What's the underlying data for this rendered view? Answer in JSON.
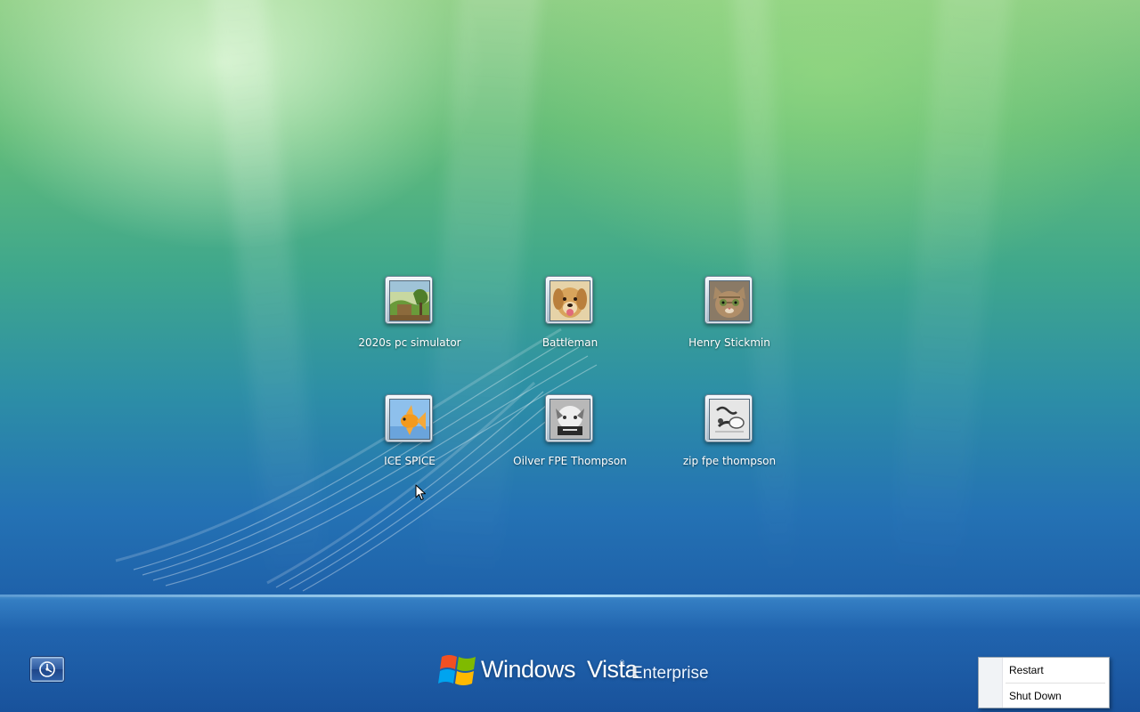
{
  "users": [
    {
      "name": "2020s pc simulator",
      "picture": "landscape-picture"
    },
    {
      "name": "Battleman",
      "picture": "dog-picture"
    },
    {
      "name": "Henry Stickmin",
      "picture": "kitten-picture"
    },
    {
      "name": "ICE SPICE",
      "picture": "goldfish-picture"
    },
    {
      "name": "Oilver FPE Thompson",
      "picture": "grayscale-picture"
    },
    {
      "name": "zip fpe thompson",
      "picture": "sketch-picture"
    }
  ],
  "branding": {
    "windows": "Windows",
    "vista": "Vista",
    "trademark": "®",
    "edition": "Enterprise"
  },
  "power_menu": {
    "items": [
      "Restart",
      "Shut Down"
    ]
  },
  "ease_of_access": {
    "icon": "ease-of-access-icon"
  },
  "colors": {
    "background_top": "#8fcf86",
    "background_bottom": "#18519a",
    "menu_background": "#ffffff"
  }
}
